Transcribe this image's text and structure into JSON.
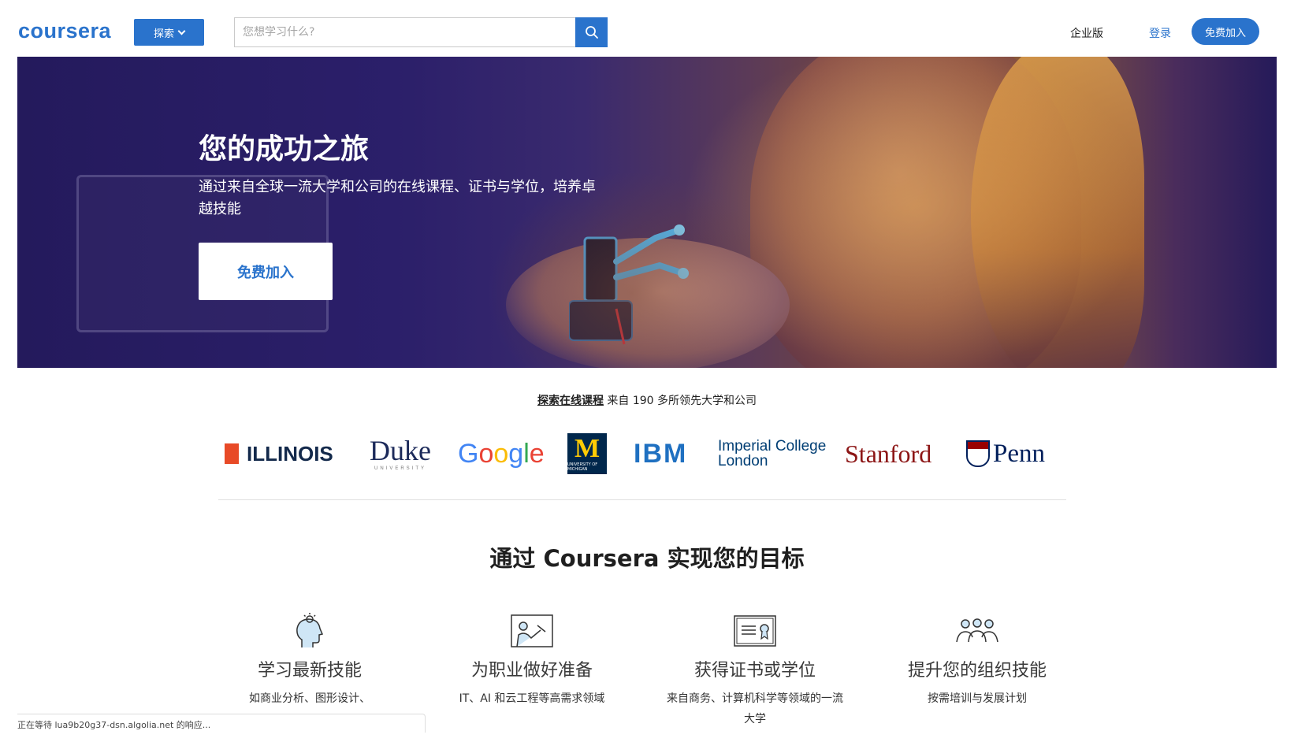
{
  "header": {
    "logo": "coursera",
    "explore_label": "探索",
    "search_placeholder": "您想学习什么?",
    "enterprise_label": "企业版",
    "login_label": "登录",
    "join_label": "免费加入"
  },
  "hero": {
    "title": "您的成功之旅",
    "subtitle": "通过来自全球一流大学和公司的在线课程、证书与学位，培养卓越技能",
    "cta_label": "免费加入"
  },
  "partners": {
    "link_text": "探索在线课程",
    "text": " 来自 190 多所领先大学和公司",
    "logos": {
      "illinois": "ILLINOIS",
      "duke": "Duke",
      "duke_sub": "UNIVERSITY",
      "google": "Google",
      "michigan": "M",
      "michigan_sub": "UNIVERSITY OF MICHIGAN",
      "ibm": "IBM",
      "imperial_line1": "Imperial College",
      "imperial_line2": "London",
      "stanford": "Stanford",
      "penn": "Penn"
    }
  },
  "goals": {
    "title": "通过 Coursera 实现您的目标",
    "items": [
      {
        "icon": "head-lightbulb-icon",
        "title": "学习最新技能",
        "desc": "如商业分析、图形设计、"
      },
      {
        "icon": "whiteboard-presenter-icon",
        "title": "为职业做好准备",
        "desc": "IT、AI 和云工程等高需求领域"
      },
      {
        "icon": "certificate-icon",
        "title": "获得证书或学位",
        "desc": "来自商务、计算机科学等领域的一流大学"
      },
      {
        "icon": "people-group-icon",
        "title": "提升您的组织技能",
        "desc": "按需培训与发展计划"
      }
    ]
  },
  "statusbar": {
    "text": "正在等待 lua9b20g37-dsn.algolia.net 的响应..."
  },
  "colors": {
    "brand_blue": "#2a73cc",
    "hero_purple": "#2b1f6a",
    "text_dark": "#1f1f1f"
  }
}
